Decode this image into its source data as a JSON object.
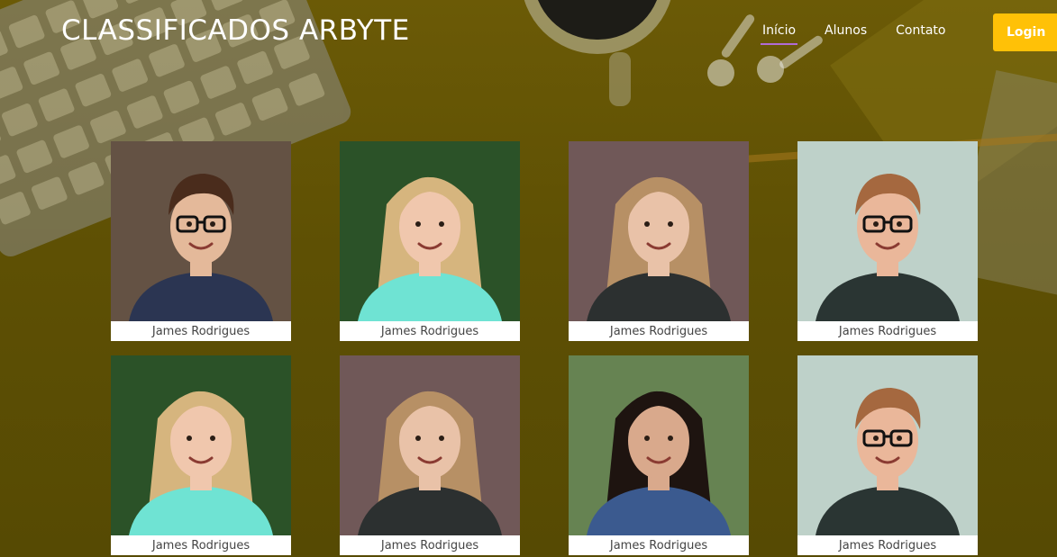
{
  "header": {
    "brand": "CLASSIFICADOS ARBYTE",
    "nav": [
      {
        "label": "Início",
        "active": true
      },
      {
        "label": "Alunos",
        "active": false
      },
      {
        "label": "Contato",
        "active": false
      }
    ],
    "login_label": "Login",
    "login_color": "#ffc107",
    "active_underline_color": "#b06bd6"
  },
  "students": [
    {
      "name": "James Rodrigues",
      "photo": "man-glasses-suit",
      "bg": "#6d5a4a",
      "hair": "#4a2c1c",
      "skin": "#e4b99a",
      "shirt": "#2b3552",
      "glasses": true,
      "long_hair": false
    },
    {
      "name": "James Rodrigues",
      "photo": "woman-blonde-teal",
      "bg": "#2f5a2c",
      "hair": "#d6b57e",
      "skin": "#f0c7ad",
      "shirt": "#6fe3d3",
      "glasses": false,
      "long_hair": true
    },
    {
      "name": "James Rodrigues",
      "photo": "woman-graffiti-wall",
      "bg": "#7a6060",
      "hair": "#b79065",
      "skin": "#e9c2a8",
      "shirt": "#2c3030",
      "glasses": false,
      "long_hair": true
    },
    {
      "name": "James Rodrigues",
      "photo": "man-glasses-tshirt",
      "bg": "#cfe3db",
      "hair": "#a5683f",
      "skin": "#eab79a",
      "shirt": "#2a3533",
      "glasses": true,
      "long_hair": false
    },
    {
      "name": "James Rodrigues",
      "photo": "woman-blonde-teal",
      "bg": "#2f5a2c",
      "hair": "#d6b57e",
      "skin": "#f0c7ad",
      "shirt": "#6fe3d3",
      "glasses": false,
      "long_hair": true
    },
    {
      "name": "James Rodrigues",
      "photo": "woman-graffiti-wall",
      "bg": "#7a6060",
      "hair": "#b79065",
      "skin": "#e9c2a8",
      "shirt": "#2c3030",
      "glasses": false,
      "long_hair": true
    },
    {
      "name": "James Rodrigues",
      "photo": "woman-denim-jacket",
      "bg": "#6f8f5a",
      "hair": "#1e1410",
      "skin": "#d9a98c",
      "shirt": "#3b5a8f",
      "glasses": false,
      "long_hair": true
    },
    {
      "name": "James Rodrigues",
      "photo": "man-glasses-tshirt",
      "bg": "#cfe3db",
      "hair": "#a5683f",
      "skin": "#eab79a",
      "shirt": "#2a3533",
      "glasses": true,
      "long_hair": false
    }
  ]
}
